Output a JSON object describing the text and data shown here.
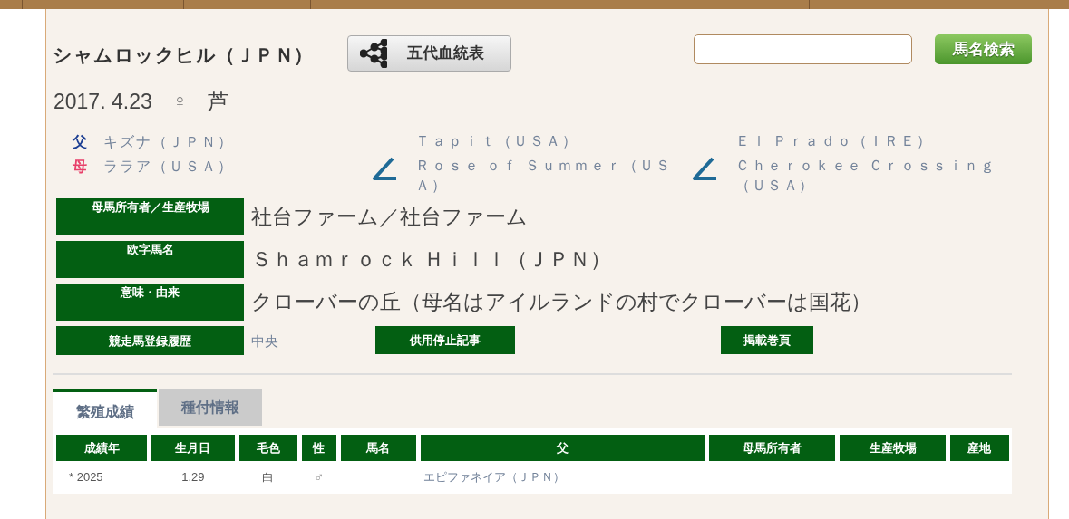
{
  "header": {
    "title": "シャムロックヒル（ＪＰＮ）",
    "pedigree_button": "五代血統表",
    "search_button": "馬名検索"
  },
  "profile": {
    "birth_date": "2017. 4.23",
    "sex": "♀",
    "coat": "芦"
  },
  "parents": [
    {
      "kind": "sire",
      "label": "父",
      "name": "キズナ（ＪＰＮ）"
    },
    {
      "kind": "dam",
      "label": "母",
      "name": "ララア（ＵＳＡ）"
    }
  ],
  "dam_lines": [
    [
      "Ｔａｐｉｔ（ＵＳＡ）",
      "Ｒｏｓｅ ｏｆ Ｓｕｍｍｅｒ（ＵＳＡ）"
    ],
    [
      "Ｅｌ Ｐｒａｄｏ（ＩＲＥ）",
      "Ｃｈｅｒｏｋｅｅ Ｃｒｏｓｓｉｎｇ（ＵＳＡ）"
    ]
  ],
  "info": [
    {
      "kind": "text",
      "label": "母馬所有者／生産牧場",
      "value": "社台ファーム／社台ファーム"
    },
    {
      "kind": "text",
      "label": "欧字馬名",
      "value": "Ｓｈａｍｒｏｃｋ Ｈｉｌｌ（ＪＰＮ）"
    },
    {
      "kind": "text",
      "label": "意味・由来",
      "value": "クローバーの丘（母名はアイルランドの村でクローバーは国花）"
    },
    {
      "kind": "links",
      "label": "競走馬登録履歴",
      "value": "中央",
      "buttons": [
        "供用停止記事",
        "掲載巻頁"
      ]
    }
  ],
  "tabs": [
    {
      "label": "繁殖成績",
      "selected": true
    },
    {
      "label": "種付情報",
      "selected": false
    }
  ],
  "table": {
    "columns": [
      "成績年",
      "生月日",
      "毛色",
      "性",
      "馬名",
      "父",
      "母馬所有者",
      "生産牧場",
      "産地"
    ],
    "rows": [
      [
        "* 2025",
        "1.29",
        "白",
        "♂",
        "",
        "エピファネイア（ＪＰＮ）",
        "",
        "",
        ""
      ]
    ]
  }
}
